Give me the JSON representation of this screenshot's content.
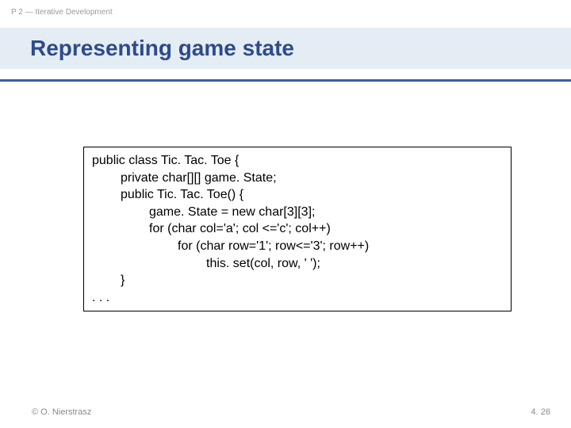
{
  "header": {
    "label": "P 2 — Iterative Development"
  },
  "title": "Representing game state",
  "code": {
    "l0": "public class Tic. Tac. Toe {",
    "l1": "private char[][] game. State;",
    "l2": "public Tic. Tac. Toe() {",
    "l3": "game. State = new char[3][3];",
    "l4": "for (char col='a'; col <='c'; col++)",
    "l5": "for (char row='1'; row<='3'; row++)",
    "l6": "this. set(col, row, ' ');",
    "l7": "}",
    "l8": ". . ."
  },
  "footer": {
    "copyright": "© O. Nierstrasz",
    "pagenum": "4. 26"
  }
}
